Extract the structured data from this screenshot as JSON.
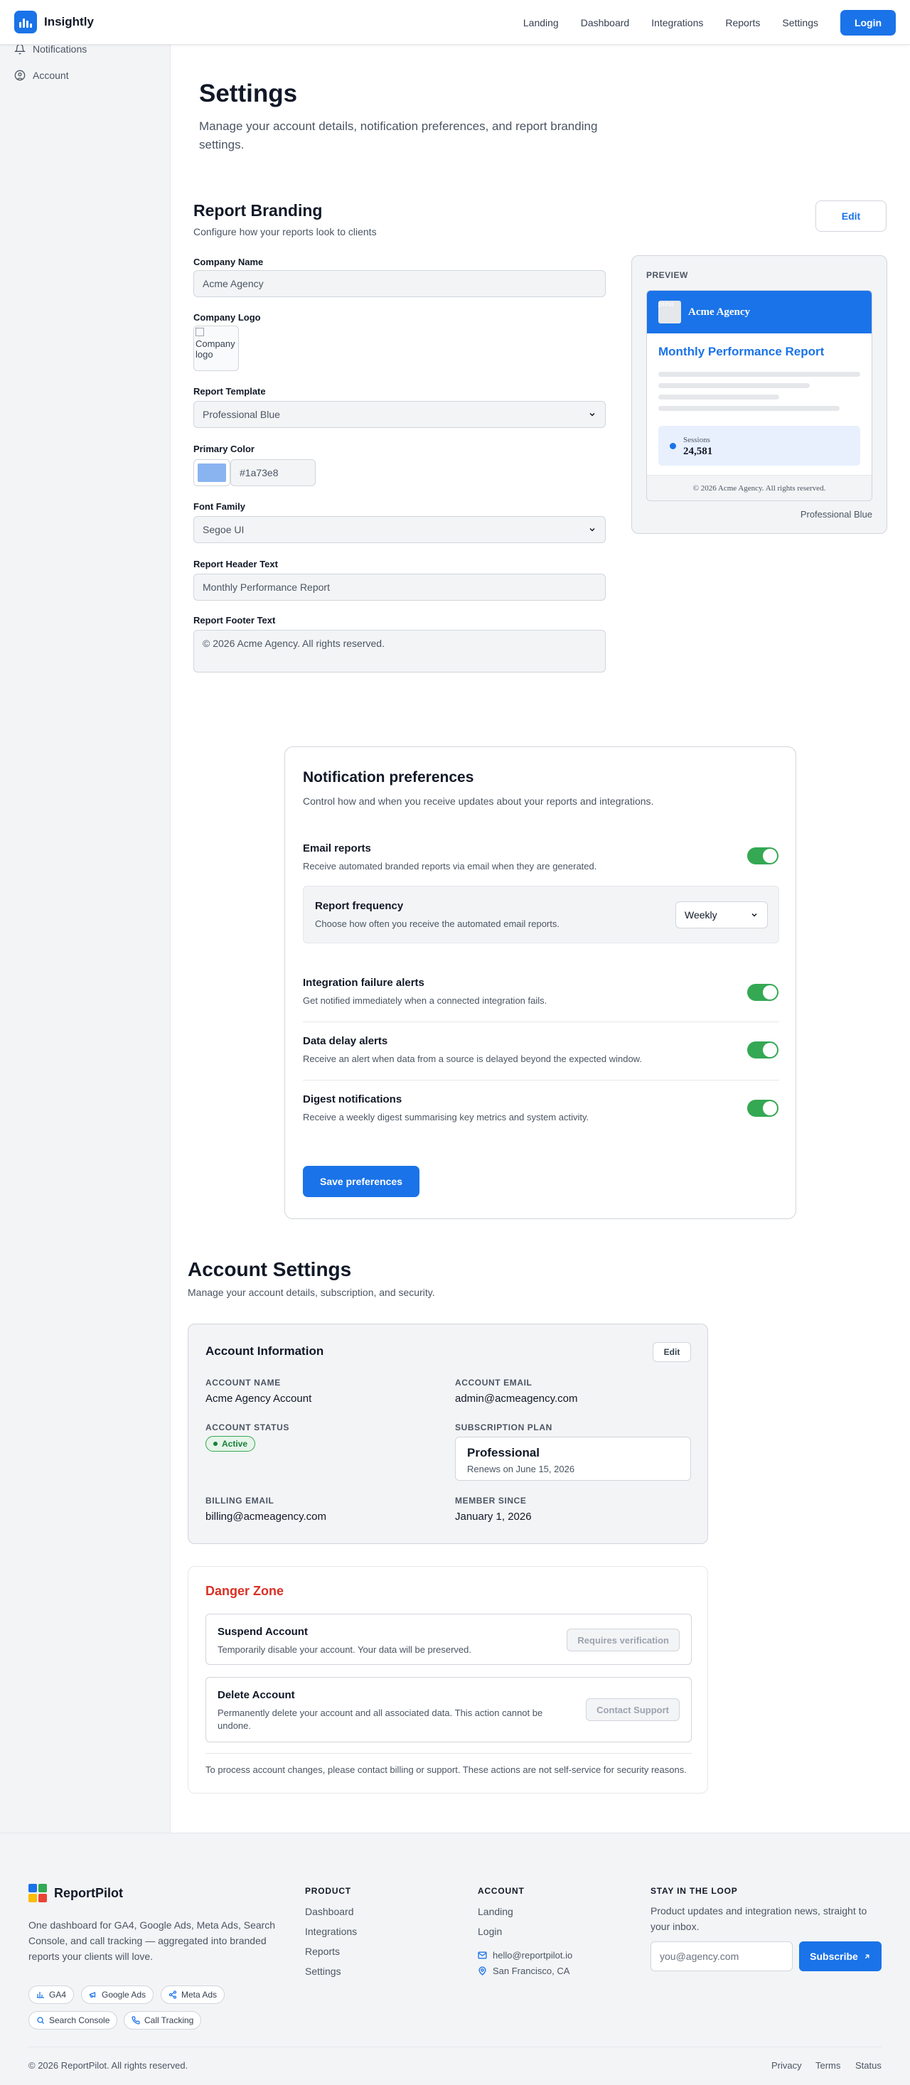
{
  "nav": {
    "brand": "Insightly",
    "links": [
      "Landing",
      "Dashboard",
      "Integrations",
      "Reports",
      "Settings"
    ],
    "login": "Login"
  },
  "sidebar": {
    "items": [
      {
        "label": "Notifications",
        "icon": "bell-icon"
      },
      {
        "label": "Account",
        "icon": "user-circle-icon"
      }
    ]
  },
  "page": {
    "title": "Settings",
    "subtitle": "Manage your account details, notification preferences, and report branding settings."
  },
  "branding": {
    "title": "Report Branding",
    "subtitle": "Configure how your reports look to clients",
    "edit": "Edit",
    "company_name_label": "Company Name",
    "company_name": "Acme Agency",
    "logo_label": "Company Logo",
    "logo_alt": "Company logo",
    "template_label": "Report Template",
    "template": "Professional Blue",
    "color_label": "Primary Color",
    "color": "#1a73e8",
    "font_label": "Font Family",
    "font": "Segoe UI",
    "header_label": "Report Header Text",
    "header": "Monthly Performance Report",
    "footer_label": "Report Footer Text",
    "footer": "© 2026 Acme Agency. All rights reserved.",
    "preview": {
      "label": "PREVIEW",
      "img_alt": "previ",
      "company": "Acme Agency",
      "title": "Monthly Performance Report",
      "stat_label": "Sessions",
      "stat_value": "24,581",
      "footer": "© 2026 Acme Agency. All rights reserved.",
      "caption": "Professional Blue"
    }
  },
  "notifications": {
    "title": "Notification preferences",
    "subtitle": "Control how and when you receive updates about your reports and integrations.",
    "email_title": "Email reports",
    "email_sub": "Receive automated branded reports via email when they are generated.",
    "freq_title": "Report frequency",
    "freq_sub": "Choose how often you receive the automated email reports.",
    "freq_value": "Weekly",
    "integration_title": "Integration failure alerts",
    "integration_sub": "Get notified immediately when a connected integration fails.",
    "delay_title": "Data delay alerts",
    "delay_sub": "Receive an alert when data from a source is delayed beyond the expected window.",
    "digest_title": "Digest notifications",
    "digest_sub": "Receive a weekly digest summarising key metrics and system activity.",
    "save": "Save preferences"
  },
  "account": {
    "title": "Account Settings",
    "subtitle": "Manage your account details, subscription, and security.",
    "info_title": "Account Information",
    "edit": "Edit",
    "name_label": "Account Name",
    "name": "Acme Agency Account",
    "email_label": "Account Email",
    "email": "admin@acmeagency.com",
    "status_label": "Account Status",
    "status": "Active",
    "plan_label": "Subscription Plan",
    "plan": "Professional",
    "renews": "Renews on June 15, 2026",
    "billing_label": "Billing Email",
    "billing": "billing@acmeagency.com",
    "member_label": "Member Since",
    "member": "January 1, 2026"
  },
  "danger": {
    "title": "Danger Zone",
    "suspend_title": "Suspend Account",
    "suspend_sub": "Temporarily disable your account. Your data will be preserved.",
    "suspend_btn": "Requires verification",
    "delete_title": "Delete Account",
    "delete_sub": "Permanently delete your account and all associated data. This action cannot be undone.",
    "delete_btn": "Contact Support",
    "note": "To process account changes, please contact billing or support. These actions are not self-service for security reasons."
  },
  "footer": {
    "brand": "ReportPilot",
    "desc": "One dashboard for GA4, Google Ads, Meta Ads, Search Console, and call tracking — aggregated into branded reports your clients will love.",
    "chips": [
      "GA4",
      "Google Ads",
      "Meta Ads",
      "Search Console",
      "Call Tracking"
    ],
    "product_head": "PRODUCT",
    "product_links": [
      "Dashboard",
      "Integrations",
      "Reports",
      "Settings"
    ],
    "account_head": "ACCOUNT",
    "account_links": [
      "Landing",
      "Login"
    ],
    "email": "hello@reportpilot.io",
    "location": "San Francisco, CA",
    "loop_head": "STAY IN THE LOOP",
    "loop_desc": "Product updates and integration news, straight to your inbox.",
    "email_placeholder": "you@agency.com",
    "subscribe": "Subscribe",
    "copyright": "© 2026 ReportPilot. All rights reserved.",
    "bottom_links": [
      "Privacy",
      "Terms",
      "Status"
    ]
  },
  "colors": {
    "accent": "#1a73e8",
    "success": "#34a853",
    "danger": "#d93025"
  }
}
